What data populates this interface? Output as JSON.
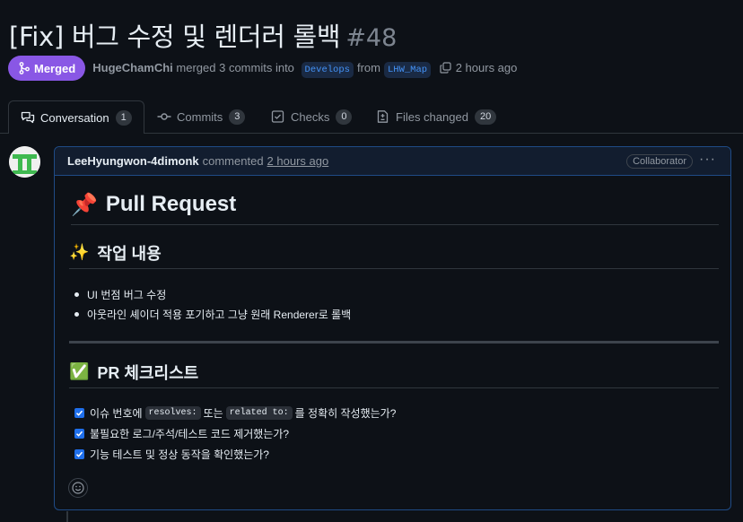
{
  "pr": {
    "title": "[Fix] 버그 수정 및 렌더러 롤백",
    "number": "#48",
    "status": "Merged",
    "author": "HugeChamChi",
    "merged_text": "merged 3 commits into",
    "base_branch": "Develops",
    "from_text": "from",
    "head_branch": "LHW_Map",
    "time": "2 hours ago"
  },
  "tabs": [
    {
      "label": "Conversation",
      "count": "1"
    },
    {
      "label": "Commits",
      "count": "3"
    },
    {
      "label": "Checks",
      "count": "0"
    },
    {
      "label": "Files changed",
      "count": "20"
    }
  ],
  "comment": {
    "author": "LeeHyungwon-4dimonk",
    "action": "commented",
    "time": "2 hours ago",
    "role": "Collaborator",
    "h1": "Pull Request",
    "h1_emoji": "📌",
    "section1": {
      "emoji": "✨",
      "title": "작업 내용"
    },
    "bullets": [
      "UI 번점 버그 수정",
      "아웃라인 셰이더 적용 포기하고 그냥 원래 Renderer로 롤백"
    ],
    "section2": {
      "emoji": "✅",
      "title": "PR 체크리스트"
    },
    "checklist": {
      "item1_a": "이슈 번호에",
      "item1_code1": "resolves:",
      "item1_b": "또는",
      "item1_code2": "related to:",
      "item1_c": "를 정확히 작성했는가?",
      "item2": "불필요한 로그/주석/테스트 코드 제거했는가?",
      "item3": "기능 테스트 및 정상 동작을 확인했는가?"
    }
  },
  "colors": {
    "merged": "#8957e5",
    "accent": "#1f6feb",
    "link": "#4493f8",
    "background": "#0d1117"
  }
}
